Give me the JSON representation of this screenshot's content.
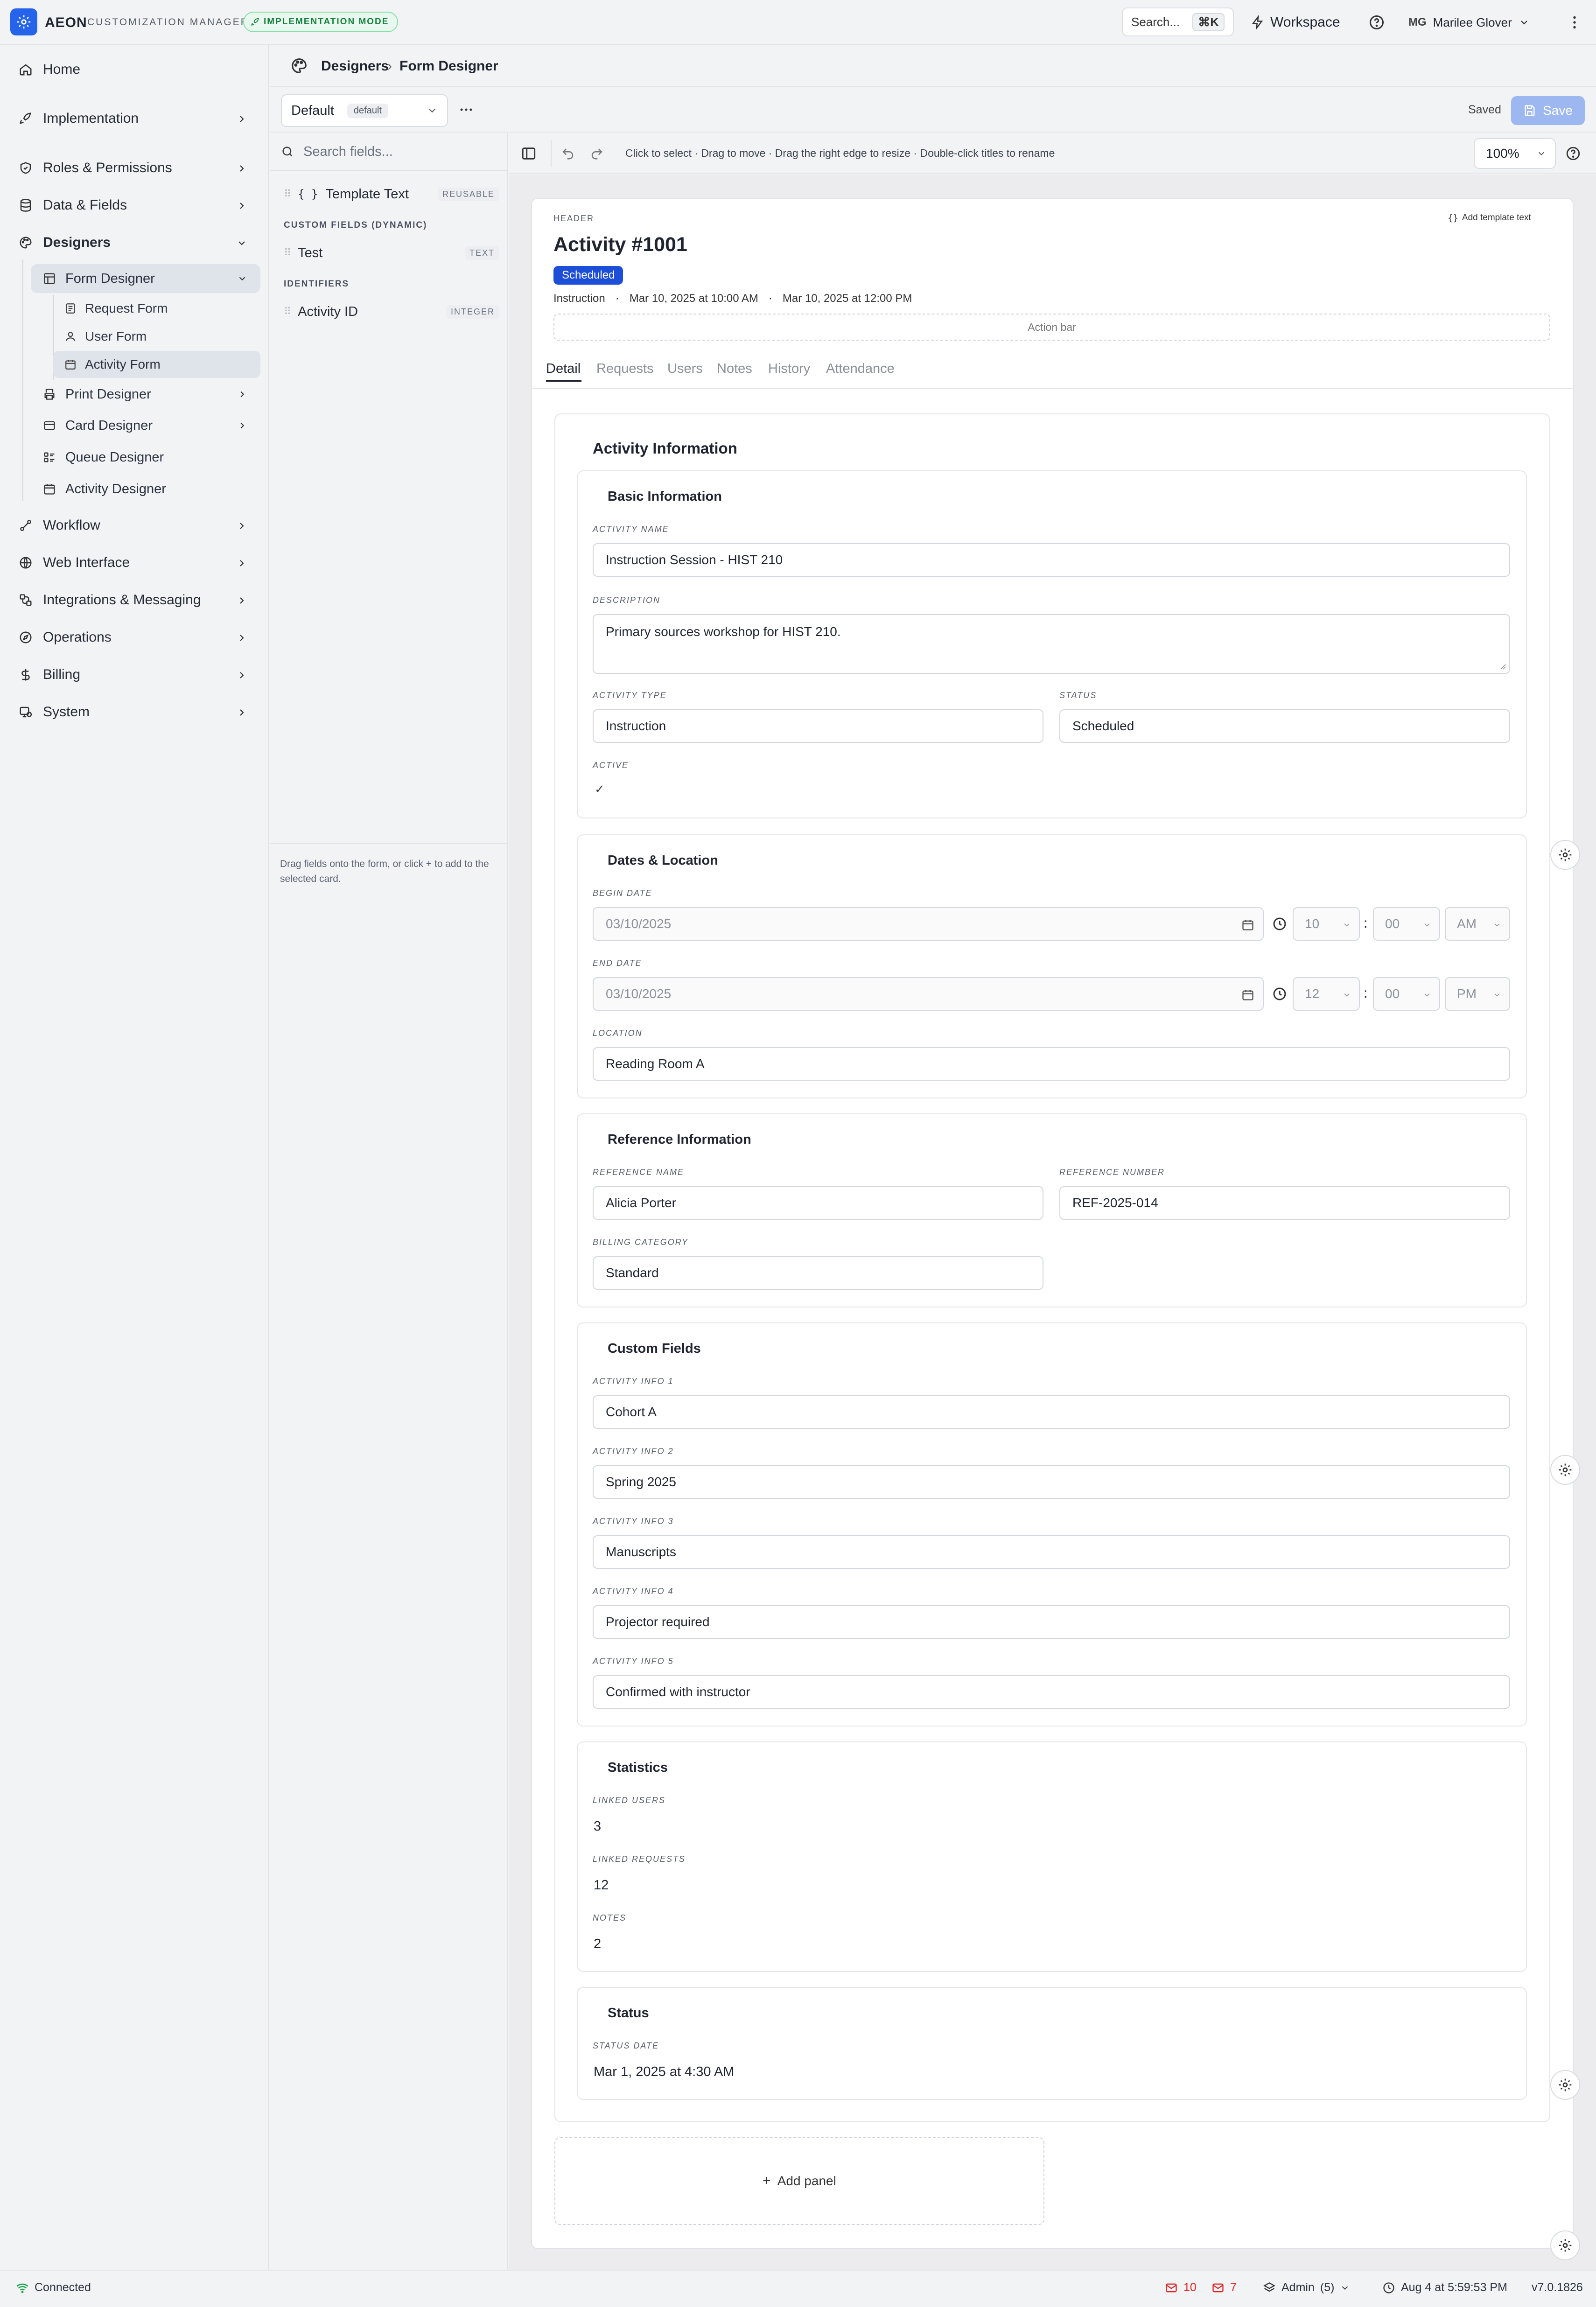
{
  "app": {
    "brand": "AEON",
    "subtitle": "CUSTOMIZATION MANAGER",
    "mode_badge": "IMPLEMENTATION MODE",
    "search_label": "Search...",
    "search_shortcut": "⌘K",
    "workspace_label": "Workspace",
    "user_initials": "MG",
    "user_name": "Marilee Glover"
  },
  "sidebar": {
    "home": "Home",
    "implementation": "Implementation",
    "roles": "Roles & Permissions",
    "data_fields": "Data & Fields",
    "designers": "Designers",
    "form_designer": "Form Designer",
    "request_form": "Request Form",
    "user_form": "User Form",
    "activity_form": "Activity Form",
    "print_designer": "Print Designer",
    "card_designer": "Card Designer",
    "queue_designer": "Queue Designer",
    "activity_designer": "Activity Designer",
    "workflow": "Workflow",
    "web_interface": "Web Interface",
    "integrations": "Integrations & Messaging",
    "operations": "Operations",
    "billing": "Billing",
    "system": "System"
  },
  "breadcrumb": {
    "parent": "Designers",
    "sep": "›",
    "current": "Form Designer"
  },
  "toolbar": {
    "layout_name": "Default",
    "layout_tag": "default",
    "saved_status": "Saved",
    "save_label": "Save"
  },
  "fields": {
    "search_placeholder": "Search fields...",
    "template_text": "Template Text",
    "template_tag": "REUSABLE",
    "group_custom": "CUSTOM FIELDS (DYNAMIC)",
    "test": "Test",
    "test_tag": "TEXT",
    "group_identifiers": "IDENTIFIERS",
    "activity_id": "Activity ID",
    "activity_id_tag": "INTEGER",
    "hint": "Drag fields onto the form, or click + to add to the selected card."
  },
  "canvas": {
    "hint": "Click to select · Drag to move · Drag the right edge to resize · Double-click titles to rename",
    "zoom": "100%"
  },
  "form_header": {
    "label": "HEADER",
    "add_template": "Add template text",
    "title": "Activity #1001",
    "status_badge": "Scheduled",
    "meta_type": "Instruction",
    "meta_dot": "·",
    "meta_begin": "Mar 10, 2025 at 10:00 AM",
    "meta_end": "Mar 10, 2025 at 12:00 PM",
    "action_bar": "Action bar"
  },
  "tabs": [
    "Detail",
    "Requests",
    "Users",
    "Notes",
    "History",
    "Attendance"
  ],
  "activity_info": {
    "title": "Activity Information",
    "basic": {
      "title": "Basic Information",
      "name_label": "ACTIVITY NAME",
      "name": "Instruction Session - HIST 210",
      "desc_label": "DESCRIPTION",
      "desc": "Primary sources workshop for HIST 210.",
      "type_label": "ACTIVITY TYPE",
      "type": "Instruction",
      "status_label": "STATUS",
      "status": "Scheduled",
      "active_label": "ACTIVE",
      "active_check": "✓"
    },
    "dates": {
      "title": "Dates & Location",
      "begin_label": "BEGIN DATE",
      "begin_date": "03/10/2025",
      "begin_hour": "10",
      "begin_min": "00",
      "begin_ampm": "AM",
      "end_label": "END DATE",
      "end_date": "03/10/2025",
      "end_hour": "12",
      "end_min": "00",
      "end_ampm": "PM",
      "time_sep": ":",
      "location_label": "LOCATION",
      "location": "Reading Room A"
    },
    "reference": {
      "title": "Reference Information",
      "name_label": "REFERENCE NAME",
      "name": "Alicia Porter",
      "number_label": "REFERENCE NUMBER",
      "number": "REF-2025-014",
      "billing_label": "BILLING CATEGORY",
      "billing": "Standard"
    },
    "custom": {
      "title": "Custom Fields",
      "l1": "ACTIVITY INFO 1",
      "v1": "Cohort A",
      "l2": "ACTIVITY INFO 2",
      "v2": "Spring 2025",
      "l3": "ACTIVITY INFO 3",
      "v3": "Manuscripts",
      "l4": "ACTIVITY INFO 4",
      "v4": "Projector required",
      "l5": "ACTIVITY INFO 5",
      "v5": "Confirmed with instructor"
    },
    "statistics": {
      "title": "Statistics",
      "users_label": "LINKED USERS",
      "users": "3",
      "requests_label": "LINKED REQUESTS",
      "requests": "12",
      "notes_label": "NOTES",
      "notes": "2"
    },
    "status": {
      "title": "Status",
      "date_label": "STATUS DATE",
      "date": "Mar 1, 2025 at 4:30 AM"
    }
  },
  "add_panel": "Add panel",
  "statusbar": {
    "connection": "Connected",
    "mail_count_1": "10",
    "mail_count_2": "7",
    "role": "Admin",
    "role_count": "(5)",
    "datetime": "Aug 4 at 5:59:53 PM",
    "version": "v7.0.1826"
  },
  "colors": {
    "accent": "#2563eb",
    "save_disabled": "#9db7f0",
    "mode_green": "#15803d",
    "status_badge": "#1d4ed8",
    "mail_red": "#dc2626"
  }
}
